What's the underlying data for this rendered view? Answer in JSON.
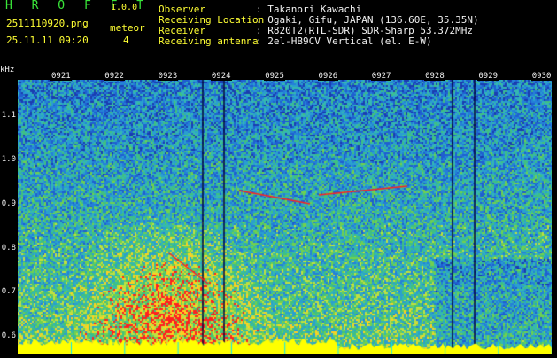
{
  "header": {
    "app_title": "H R O F F T",
    "version": "1.0.0",
    "filename": "2511110920.png",
    "timestamp": "25.11.11 09:20",
    "meteor_label": "meteor",
    "meteor_count": "4",
    "fields": [
      {
        "label": "Observer",
        "value": ": Takanori Kawachi"
      },
      {
        "label": "Receiving Location",
        "value": ": Ogaki, Gifu, JAPAN (136.60E, 35.35N)"
      },
      {
        "label": "Receiver",
        "value": ": R820T2(RTL-SDR) SDR-Sharp 53.372MHz"
      },
      {
        "label": "Receiving antenna",
        "value": ": 2el-HB9CV Vertical (el. E-W)"
      }
    ]
  },
  "spectrogram": {
    "y_unit": "kHz",
    "y_ticks": [
      "1.1",
      "1.0",
      "0.9",
      "0.8",
      "0.7",
      "0.6"
    ],
    "x_ticks": [
      "0921",
      "0922",
      "0923",
      "0924",
      "0925",
      "0926",
      "0927",
      "0928",
      "0929",
      "0930"
    ],
    "colors": {
      "background": "#1a3fb0",
      "noise_low": "#1f5fd0",
      "noise_mid": "#2a9fcf",
      "noise_high": "#40c080",
      "signal": "#ff2020",
      "floor": "#ffff00",
      "tick": "#00e5ff"
    }
  }
}
